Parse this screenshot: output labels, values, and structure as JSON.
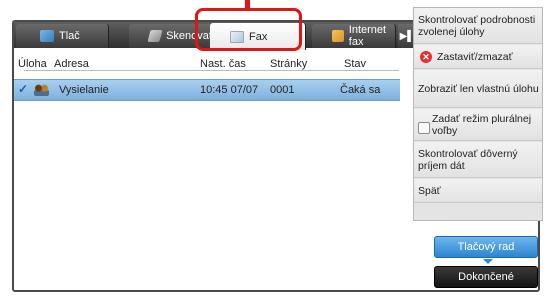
{
  "tabs": {
    "print": "Tlač",
    "scan": "Skenovať",
    "fax": "Fax",
    "internet_fax": "Internet fax",
    "more_arrow": "▶▌"
  },
  "table": {
    "columns": [
      "Úloha",
      "Adresa",
      "Nast. čas",
      "Stránky",
      "Stav"
    ],
    "rows": [
      {
        "task": "Vysielanie",
        "address": "",
        "time": "10:45 07/07",
        "pages": "0001",
        "status": "Čaká sa"
      }
    ]
  },
  "sidebar": {
    "items": [
      "Skontrolovať podrobnosti zvolenej úlohy",
      "Zastaviť/zmazať",
      "Zobraziť len vlastnú úlohu",
      "Zadať režim plurálnej voľby",
      "Skontrolovať dôverný príjem dát",
      "Späť"
    ]
  },
  "buttons": {
    "queue": "Tlačový rad",
    "done": "Dokončené"
  },
  "colors": {
    "highlight": "#e01515",
    "selected_row": "#8dbfe6",
    "tabbar": "#3c3c3c",
    "queue_button": "#2d85cf"
  }
}
